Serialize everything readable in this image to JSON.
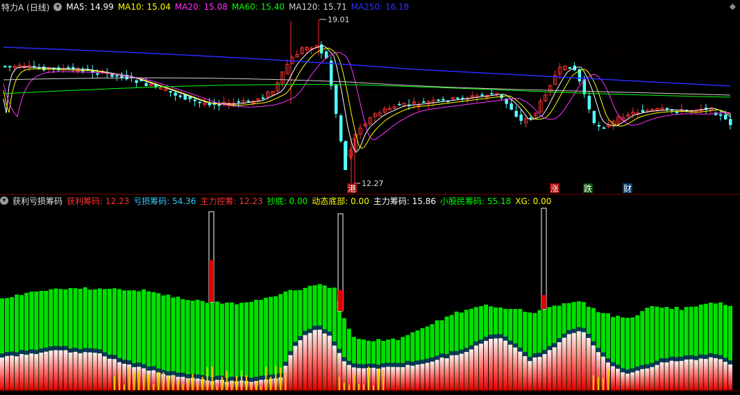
{
  "main": {
    "title": "特力A (日线)",
    "mas": [
      {
        "label": "MA5: 14.99",
        "color": "#ffffff"
      },
      {
        "label": "MA10: 15.04",
        "color": "#ffff00"
      },
      {
        "label": "MA20: 15.08",
        "color": "#ff33ff"
      },
      {
        "label": "MA60: 15.40",
        "color": "#00ff00"
      },
      {
        "label": "MA120: 15.71",
        "color": "#d0d0d0"
      },
      {
        "label": "MA250: 16.18",
        "color": "#3333ff"
      }
    ],
    "high_label": "19.01",
    "low_label": "12.27",
    "events": [
      {
        "text": "港",
        "color": "#ffffff",
        "bg": "#a00000"
      },
      {
        "text": "涨",
        "color": "#ffffff",
        "bg": "#a00000"
      },
      {
        "text": "跌",
        "color": "#ffffff",
        "bg": "#005000"
      },
      {
        "text": "财",
        "color": "#ffffff",
        "bg": "#003a6a"
      }
    ]
  },
  "sub": {
    "title": "获利亏损筹码",
    "items": [
      {
        "label": "获利筹码: 12.23",
        "color": "#ff3333"
      },
      {
        "label": "亏损筹码: 54.36",
        "color": "#33ccff"
      },
      {
        "label": "主力控筹: 12.23",
        "color": "#ff3333"
      },
      {
        "label": "抄底: 0.00",
        "color": "#00ff00"
      },
      {
        "label": "动态底部: 0.00",
        "color": "#ffff00"
      },
      {
        "label": "主力筹码: 15.86",
        "color": "#ffffff"
      },
      {
        "label": "小股民筹码: 55.18",
        "color": "#00ff00"
      },
      {
        "label": "XG: 0.00",
        "color": "#ffff00"
      }
    ]
  },
  "icons": {
    "circle": "chevron-down-icon",
    "expand": "expand-icon"
  }
}
